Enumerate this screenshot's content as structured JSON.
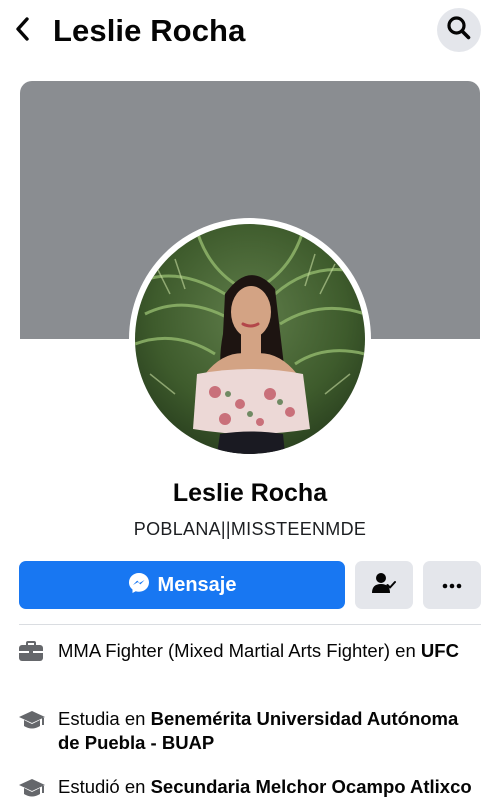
{
  "header": {
    "title": "Leslie Rocha",
    "back_icon": "chevron-left-icon",
    "search_icon": "search-icon"
  },
  "profile": {
    "name": "Leslie Rocha",
    "bio": "POBLANA||MISSTEENMDE"
  },
  "actions": {
    "message_label": "Mensaje",
    "message_icon": "messenger-icon",
    "friend_icon": "friend-status-icon",
    "more_icon": "more-icon"
  },
  "details": [
    {
      "icon": "briefcase-icon",
      "prefix": "MMA Fighter (Mixed Martial Arts Fighter) en ",
      "bold": "UFC"
    },
    {
      "icon": "graduation-cap-icon",
      "prefix": "Estudia en ",
      "bold": "Benemérita Universidad Autónoma de Puebla - BUAP"
    },
    {
      "icon": "graduation-cap-icon",
      "prefix": "Estudió en ",
      "bold": "Secundaria Melchor Ocampo Atlixco"
    }
  ],
  "colors": {
    "accent": "#1877f2",
    "cover": "#8a8d91",
    "button_secondary": "#e4e6eb"
  }
}
